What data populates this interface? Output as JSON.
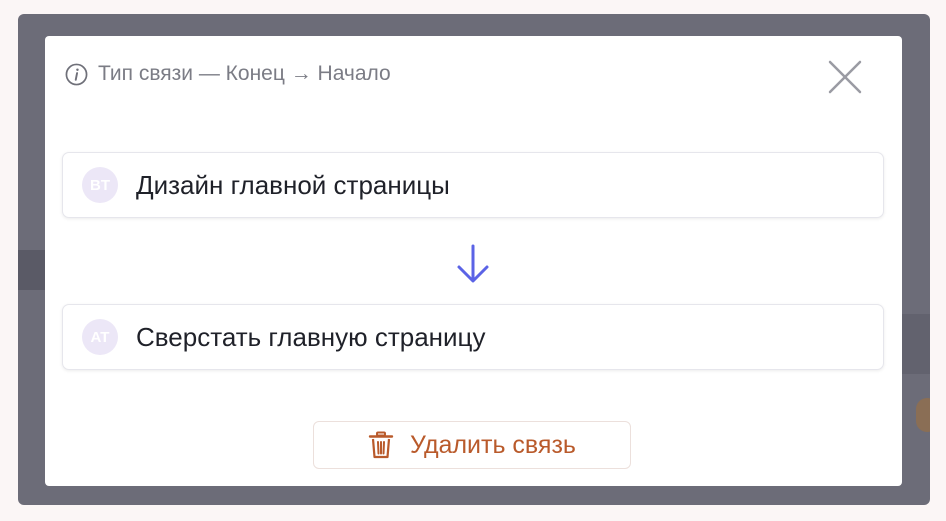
{
  "dialog": {
    "header_text": "Тип связи — Конец → Начало",
    "icons": {
      "info": "info-icon",
      "close": "close-icon"
    }
  },
  "tasks": [
    {
      "avatar_initials": "BT",
      "title": "Дизайн главной страницы"
    },
    {
      "avatar_initials": "AT",
      "title": "Сверстать главную страницу"
    }
  ],
  "connector": {
    "icon": "arrow-down-icon",
    "color": "#5b63e6"
  },
  "actions": {
    "delete_label": "Удалить связь",
    "delete_icon": "trash-icon",
    "delete_color": "#b95a2b"
  }
}
